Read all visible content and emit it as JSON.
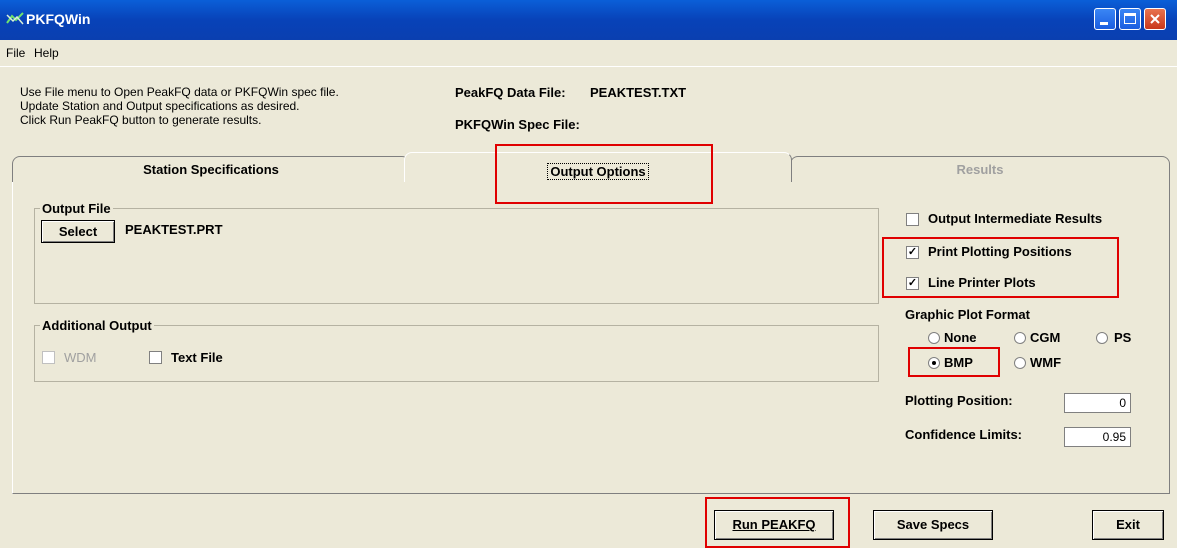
{
  "window": {
    "title": "PKFQWin"
  },
  "menu": {
    "items": [
      "File",
      "Help"
    ]
  },
  "instructions": [
    "Use File menu to Open PeakFQ data or PKFQWin spec file.",
    "Update Station and Output specifications as desired.",
    "Click Run PeakFQ button to generate results."
  ],
  "files": {
    "data_label": "PeakFQ Data File:",
    "data_value": "PEAKTEST.TXT",
    "spec_label": "PKFQWin Spec File:",
    "spec_value": ""
  },
  "tabs": [
    {
      "label": "Station Specifications",
      "active": false
    },
    {
      "label": "Output Options",
      "active": true
    },
    {
      "label": "Results",
      "active": false,
      "disabled": true
    }
  ],
  "output_file": {
    "group_label": "Output File",
    "select_label": "Select",
    "file_name": "PEAKTEST.PRT"
  },
  "additional_output": {
    "group_label": "Additional Output",
    "wdm_label": "WDM",
    "wdm_checked": false,
    "text_file_label": "Text File",
    "text_file_checked": false
  },
  "options": {
    "intermediate_label": "Output Intermediate Results",
    "intermediate_checked": false,
    "plotting_positions_label": "Print Plotting Positions",
    "plotting_positions_checked": true,
    "line_printer_label": "Line Printer Plots",
    "line_printer_checked": true
  },
  "graphic_plot": {
    "label": "Graphic Plot Format",
    "options": [
      "None",
      "CGM",
      "PS",
      "BMP",
      "WMF"
    ],
    "selected": "BMP"
  },
  "plotting_position": {
    "label": "Plotting Position:",
    "value": "0"
  },
  "confidence_limits": {
    "label": "Confidence Limits:",
    "value": "0.95"
  },
  "buttons": {
    "run": "Run PEAKFQ",
    "save": "Save Specs",
    "exit": "Exit"
  }
}
